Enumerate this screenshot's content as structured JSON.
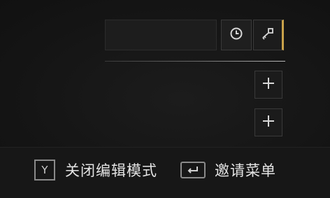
{
  "toolbar": {
    "time_icon": "clock-icon",
    "key_icon": "key-icon"
  },
  "slots": {
    "add_icon": "plus-icon"
  },
  "footer": {
    "edit_key": "Y",
    "edit_label": "关闭编辑模式",
    "invite_key_icon": "enter-key-icon",
    "invite_label": "邀请菜单"
  },
  "colors": {
    "background": "#141414",
    "accent": "#c9a24a",
    "text": "#e4e4e4",
    "border": "#3a3a3a"
  }
}
